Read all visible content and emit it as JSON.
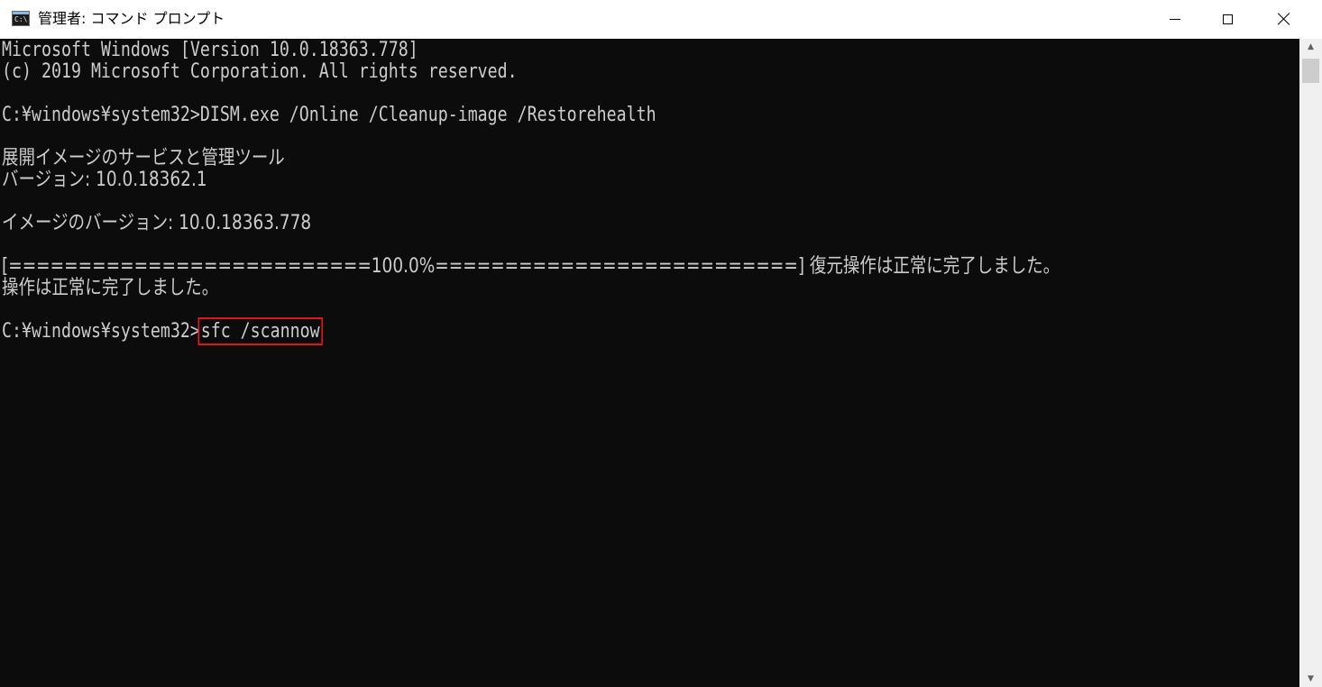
{
  "window": {
    "title": "管理者: コマンド プロンプト",
    "icon_text": "C:\\."
  },
  "controls": {
    "minimize_icon": "minimize-icon",
    "maximize_icon": "maximize-icon",
    "close_icon": "close-icon"
  },
  "console": {
    "lines": [
      "Microsoft Windows [Version 10.0.18363.778]",
      "(c) 2019 Microsoft Corporation. All rights reserved.",
      "C:¥windows¥system32>DISM.exe /Online /Cleanup-image /Restorehealth",
      "展開イメージのサービスと管理ツール",
      "バージョン: 10.0.18362.1",
      "イメージのバージョン: 10.0.18363.778",
      "[==========================100.0%==========================] 復元操作は正常に完了しました。",
      "操作は正常に完了しました。"
    ],
    "prompt": "C:¥windows¥system32>",
    "command": "sfc /scannow",
    "highlight_color": "#e0141e",
    "background_color": "#0c0c0c",
    "text_color": "#cccccc"
  },
  "scrollbar": {
    "up_icon": "scroll-up-arrow-icon",
    "down_icon": "scroll-down-arrow-icon",
    "up_glyph": "▲",
    "down_glyph": "▼"
  }
}
